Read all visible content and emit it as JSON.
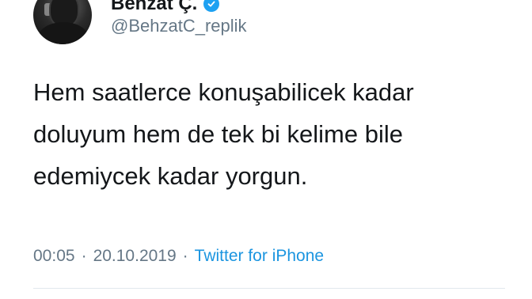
{
  "author": {
    "display_name": "Behzat Ç.",
    "handle": "@BehzatC_replik",
    "verified_icon": "verified-badge-icon"
  },
  "tweet": {
    "text": "Hem saatlerce konuşabilicek kadar\ndoluyum hem de tek bi kelime bile\nedemiycek kadar yorgun."
  },
  "meta": {
    "time": "00:05",
    "separator": "·",
    "date": "20.10.2019",
    "source": "Twitter for iPhone"
  },
  "colors": {
    "text": "#14171a",
    "secondary": "#657786",
    "link": "#1b95e0",
    "verified": "#1da1f2"
  }
}
